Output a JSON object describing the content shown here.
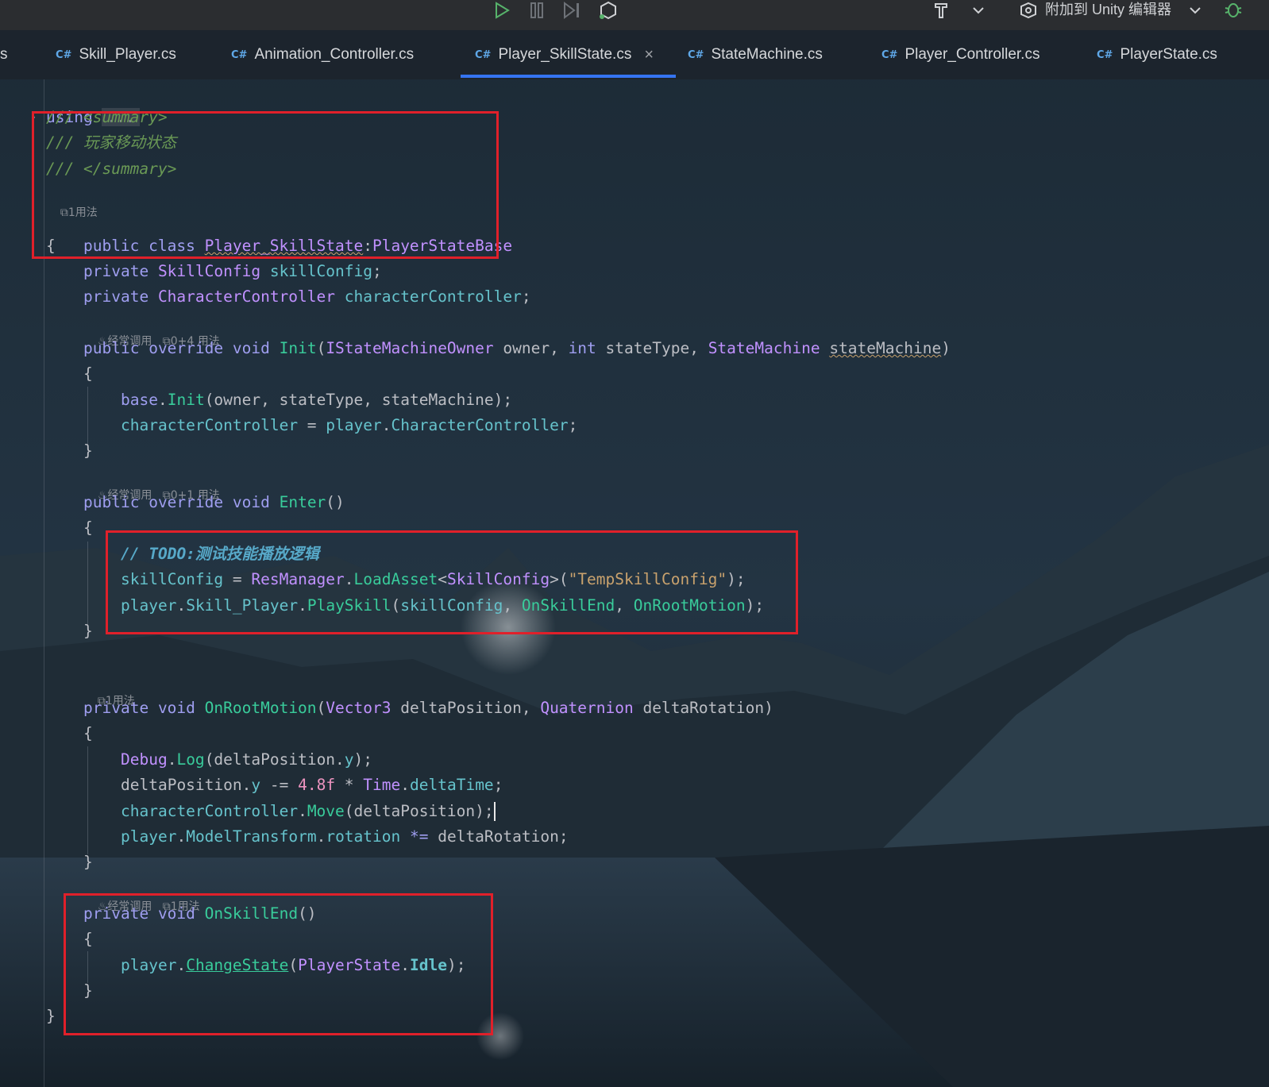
{
  "toolbar": {
    "attach_label": "附加到 Unity 编辑器"
  },
  "tabs": [
    {
      "lang": "C#",
      "label": "Skill_Player.cs"
    },
    {
      "lang": "C#",
      "label": "Animation_Controller.cs"
    },
    {
      "lang": "C#",
      "label": "Player_SkillState.cs",
      "active": true
    },
    {
      "lang": "C#",
      "label": "StateMachine.cs"
    },
    {
      "lang": "C#",
      "label": "Player_Controller.cs"
    },
    {
      "lang": "C#",
      "label": "PlayerState.cs"
    }
  ],
  "tab_partial_left": "s",
  "tab_close": "×",
  "hints": {
    "usage1": "1用法",
    "frequent": "经常调用",
    "usage_init": "0+4 用法",
    "usage_enter": "0+1 用法",
    "usage_onroot": "1用法",
    "usage_onskill": "1用法"
  },
  "code": {
    "using_kw": "using",
    "using_fold": "...",
    "summary_open": "/// <summary>",
    "summary_text": "/// 玩家移动状态",
    "summary_close": "/// </summary>",
    "class_decl_public": "public",
    "class_decl_class": "class",
    "class_name": "Player_SkillState",
    "class_colon": ":",
    "class_base": "PlayerStateBase",
    "todo": "// TODO:测试技能播放逻辑",
    "temp_skill": "\"TempSkillConfig\"",
    "num_48": "4.8f"
  },
  "colors": {
    "accent": "#3574f0",
    "highlight_box": "#e0202a",
    "keyword": "#9f9ef0",
    "type": "#c191ff",
    "method": "#39cc9b"
  }
}
